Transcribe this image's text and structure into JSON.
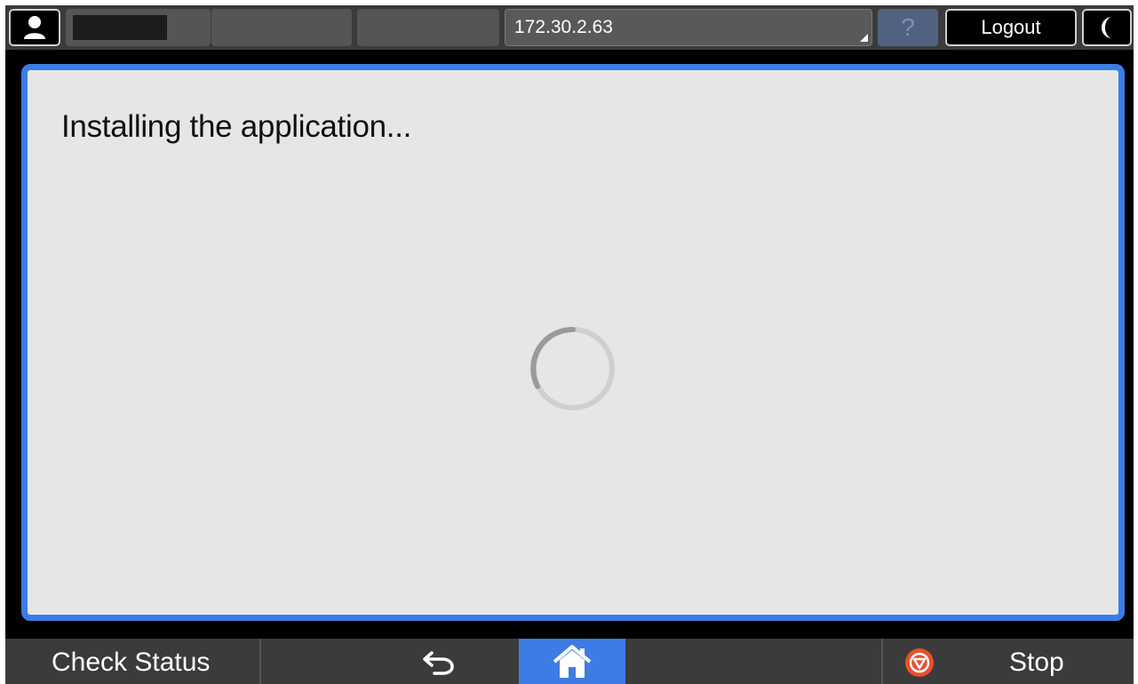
{
  "header": {
    "address": "172.30.2.63",
    "help_label": "?",
    "logout_label": "Logout"
  },
  "main": {
    "message": "Installing the application..."
  },
  "footer": {
    "check_status_label": "Check Status",
    "stop_label": "Stop"
  },
  "colors": {
    "accent_blue": "#3a7de8",
    "stop_red": "#e8502d",
    "panel_bg": "#e6e6e6",
    "bar_bg": "#3b3b3b"
  },
  "icons": [
    "user-icon",
    "moon-icon",
    "back-arrow-icon",
    "home-icon",
    "stop-icon",
    "loading-spinner"
  ]
}
